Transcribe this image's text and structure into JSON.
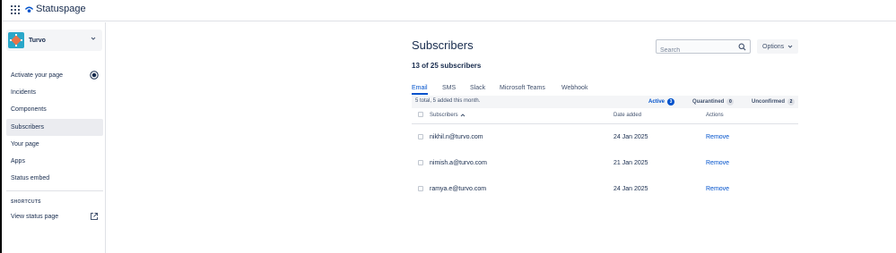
{
  "topbar": {
    "brand_name": "Statuspage",
    "apps_icon": "grid-icon",
    "brand_icon": "statuspage-logo-icon",
    "brand_color": "#0052cc"
  },
  "sidebar": {
    "page_name": "Turvo",
    "page_logo_color": "#2aa7c9",
    "items": [
      {
        "label": "Activate your page",
        "icon": "activate-status-icon"
      },
      {
        "label": "Incidents"
      },
      {
        "label": "Components"
      },
      {
        "label": "Subscribers",
        "active": true
      },
      {
        "label": "Your page"
      },
      {
        "label": "Apps"
      },
      {
        "label": "Status embed"
      }
    ],
    "shortcuts_heading": "SHORTCUTS",
    "shortcuts": [
      {
        "label": "View status page",
        "icon": "external-link-icon"
      }
    ]
  },
  "main": {
    "title": "Subscribers",
    "count_text": "13 of 25 subscribers",
    "search_placeholder": "Search",
    "options_label": "Options",
    "tabs": [
      {
        "label": "Email",
        "active": true
      },
      {
        "label": "SMS"
      },
      {
        "label": "Slack"
      },
      {
        "label": "Microsoft Teams"
      },
      {
        "label": "Webhook"
      }
    ],
    "summary": "5 total, 5 added this month.",
    "filters": [
      {
        "label": "Active",
        "count": "3",
        "active": true
      },
      {
        "label": "Quarantined",
        "count": "0"
      },
      {
        "label": "Unconfirmed",
        "count": "2"
      }
    ],
    "columns": {
      "subscribers": "Subscribers",
      "date_added": "Date added",
      "actions": "Actions"
    },
    "rows": [
      {
        "email": "nikhil.n@turvo.com",
        "date": "24 Jan 2025",
        "action": "Remove"
      },
      {
        "email": "nimish.a@turvo.com",
        "date": "21 Jan 2025",
        "action": "Remove"
      },
      {
        "email": "ramya.e@turvo.com",
        "date": "24 Jan 2025",
        "action": "Remove"
      }
    ],
    "accent_color": "#0052cc"
  }
}
